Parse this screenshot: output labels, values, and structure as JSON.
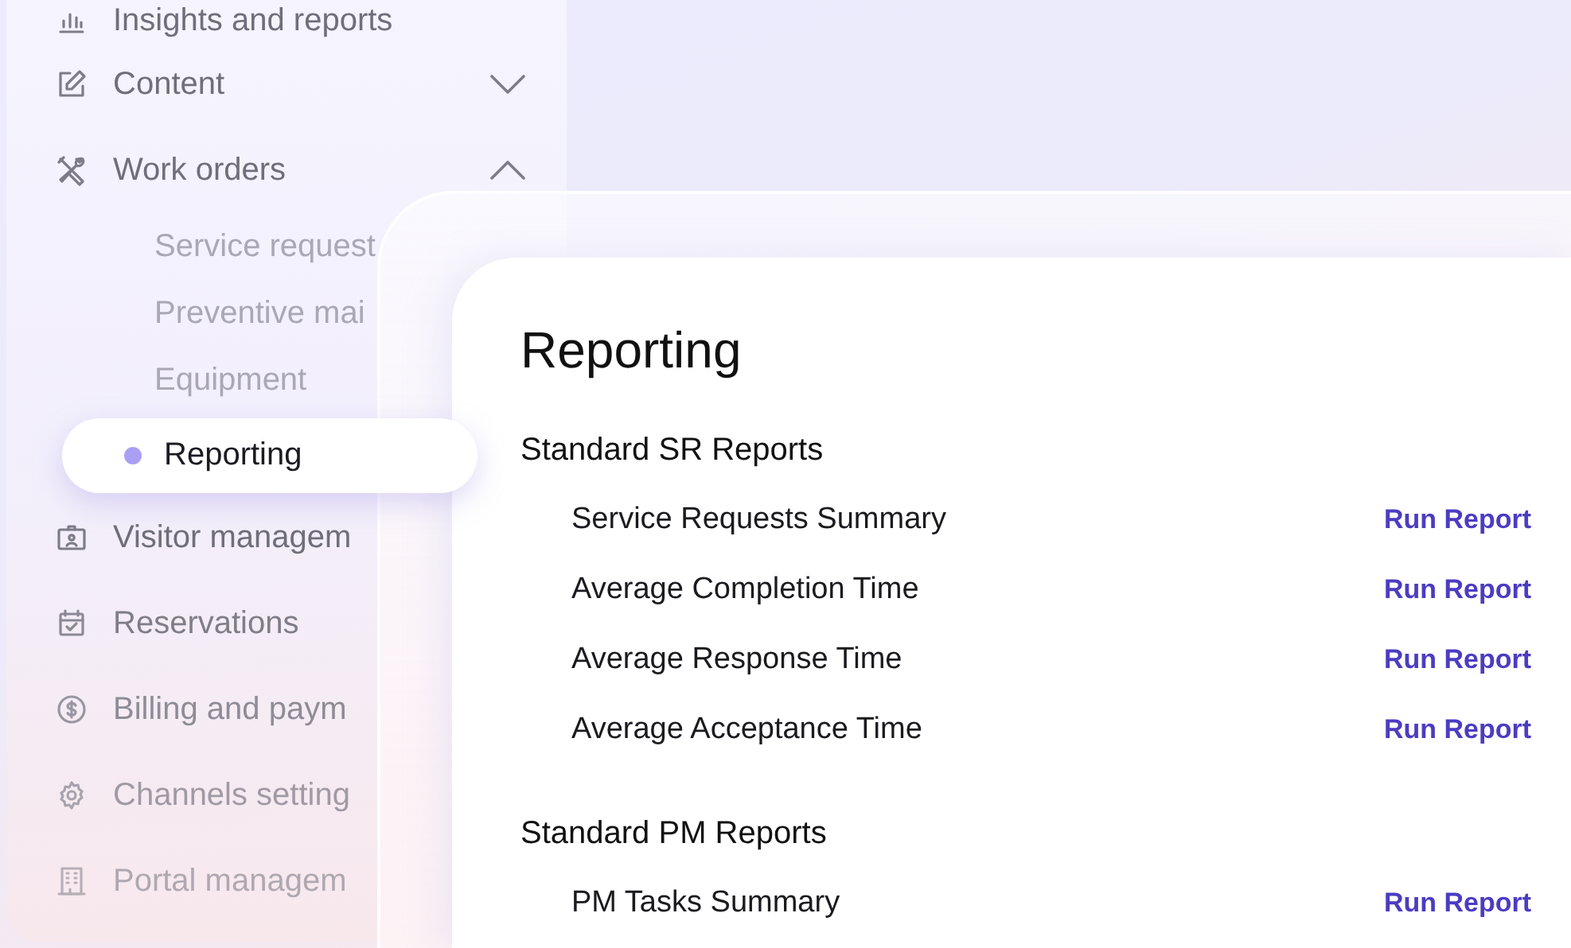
{
  "sidebar": {
    "items": [
      {
        "label": "Insights and reports"
      },
      {
        "label": "Content",
        "expanded": false
      },
      {
        "label": "Work orders",
        "expanded": true,
        "children": [
          {
            "label": "Service request",
            "selected": false
          },
          {
            "label": "Preventive mai",
            "selected": false
          },
          {
            "label": "Equipment",
            "selected": false
          },
          {
            "label": "Reporting",
            "selected": true
          }
        ]
      },
      {
        "label": "Visitor managem"
      },
      {
        "label": "Reservations"
      },
      {
        "label": "Billing and paym"
      },
      {
        "label": "Channels setting"
      },
      {
        "label": "Portal managem"
      }
    ]
  },
  "main": {
    "title": "Reporting",
    "sections": [
      {
        "heading": "Standard SR Reports",
        "reports": [
          {
            "name": "Service Requests Summary",
            "action": "Run Report"
          },
          {
            "name": "Average Completion Time",
            "action": "Run Report"
          },
          {
            "name": "Average Response Time",
            "action": "Run Report"
          },
          {
            "name": "Average Acceptance Time",
            "action": "Run Report"
          }
        ]
      },
      {
        "heading": "Standard PM Reports",
        "reports": [
          {
            "name": "PM Tasks Summary",
            "action": "Run Report"
          }
        ]
      }
    ]
  }
}
